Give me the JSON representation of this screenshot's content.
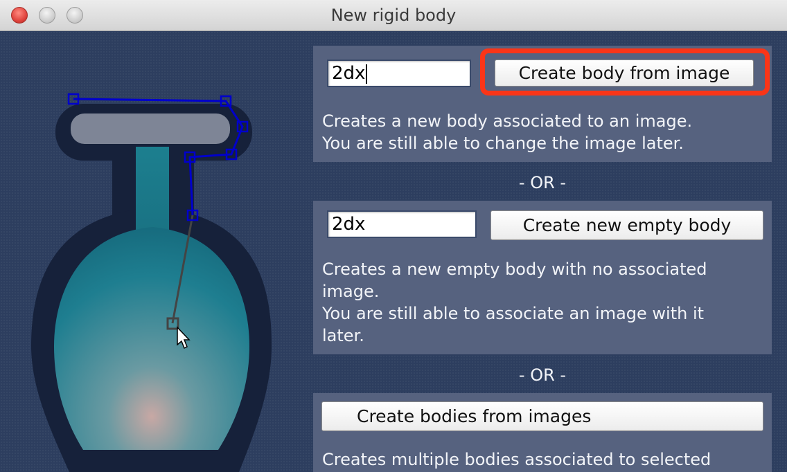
{
  "window": {
    "title": "New rigid body",
    "controls": [
      "close-button",
      "minimize-button",
      "zoom-button"
    ]
  },
  "colors": {
    "background": "#2d3e5f",
    "panel": "#56627f",
    "highlight": "#fa3518",
    "shape_outline": "#0000cc",
    "flask": "#1d7d8f"
  },
  "section1": {
    "name_value": "2dx",
    "button_label": "Create body from image",
    "description": "Creates a new body associated to an image.\nYou are still able to change the image later."
  },
  "separator1": "- OR -",
  "section2": {
    "name_value": "2dx",
    "button_label": "Create new empty body",
    "description": "Creates a new empty body with no associated\nimage.\nYou are still able to associate an image with it\nlater."
  },
  "separator2": "- OR -",
  "section3": {
    "button_label": "Create bodies from images",
    "description": "Creates multiple bodies associated to selected"
  },
  "canvas": {
    "image_name": "flask-icon",
    "polygon_vertices_count": 7
  }
}
